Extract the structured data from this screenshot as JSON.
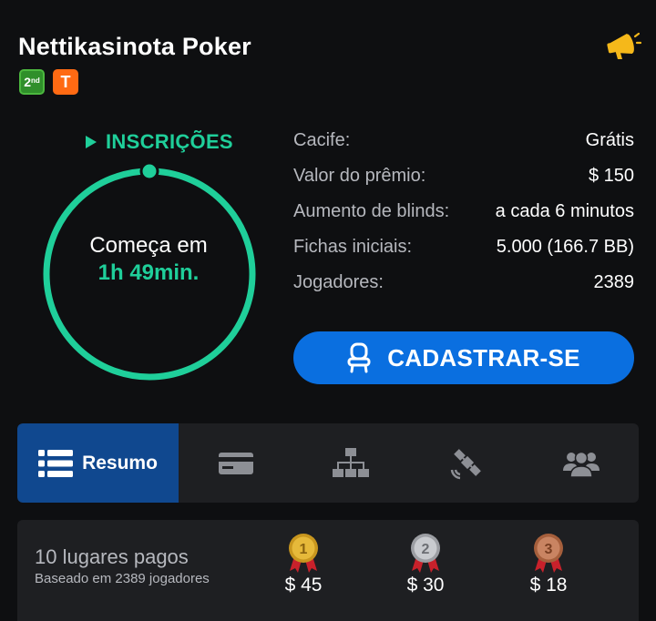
{
  "header": {
    "title": "Nettikasinota Poker",
    "badges": [
      {
        "text": "2",
        "sup": "nd",
        "color": "#2f8f2a"
      },
      {
        "text": "T",
        "color": "#ff6a13"
      }
    ],
    "announce_icon": "megaphone-icon"
  },
  "status": {
    "label": "INSCRIÇÕES",
    "starts_label": "Começa em",
    "starts_time": "1h 49min.",
    "accent": "#1fcf9a"
  },
  "info": [
    {
      "label": "Cacife:",
      "value": "Grátis"
    },
    {
      "label": "Valor do prêmio:",
      "value": "$ 150"
    },
    {
      "label": "Aumento de blinds:",
      "value": "a cada 6 minutos"
    },
    {
      "label": "Fichas iniciais:",
      "value": "5.000 (166.7 BB)"
    },
    {
      "label": "Jogadores:",
      "value": "2389"
    }
  ],
  "register": {
    "label": "CADASTRAR-SE",
    "icon": "seat-icon",
    "color": "#0a6fe0"
  },
  "tabs": [
    {
      "label": "Resumo",
      "icon": "list-icon",
      "active": true
    },
    {
      "label": "",
      "icon": "card-icon"
    },
    {
      "label": "",
      "icon": "structure-icon"
    },
    {
      "label": "",
      "icon": "satellite-icon"
    },
    {
      "label": "",
      "icon": "players-icon"
    }
  ],
  "payout": {
    "title": "10 lugares pagos",
    "subtitle": "Baseado em 2389 jogadores",
    "prizes": [
      {
        "place": "1",
        "amount": "$ 45",
        "medal": "gold-medal-icon"
      },
      {
        "place": "2",
        "amount": "$ 30",
        "medal": "silver-medal-icon"
      },
      {
        "place": "3",
        "amount": "$ 18",
        "medal": "bronze-medal-icon"
      }
    ]
  }
}
